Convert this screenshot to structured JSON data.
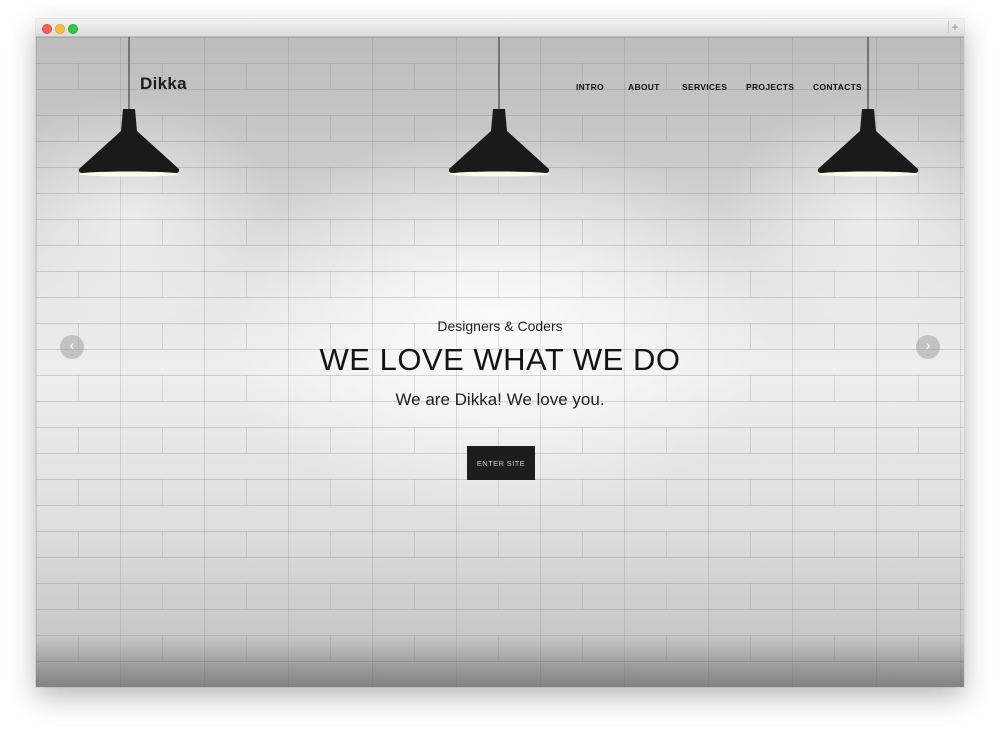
{
  "site": {
    "logo": "Dikka"
  },
  "nav": {
    "items": [
      "INTRO",
      "ABOUT",
      "SERVICES",
      "PROJECTS",
      "CONTACTS"
    ]
  },
  "hero": {
    "subtitle": "Designers & Coders",
    "title": "WE LOVE WHAT WE DO",
    "tagline": "We are Dikka! We love you.",
    "button_label": "ENTER SITE"
  },
  "slider": {
    "prev_icon": "chevron-left-icon",
    "next_icon": "chevron-right-icon",
    "prev_glyph": "‹",
    "next_glyph": "›"
  },
  "window": {
    "add_glyph": "+"
  },
  "colors": {
    "button_bg": "#1d1d1d",
    "text": "#141414",
    "lamp": "#1a1a1a"
  }
}
